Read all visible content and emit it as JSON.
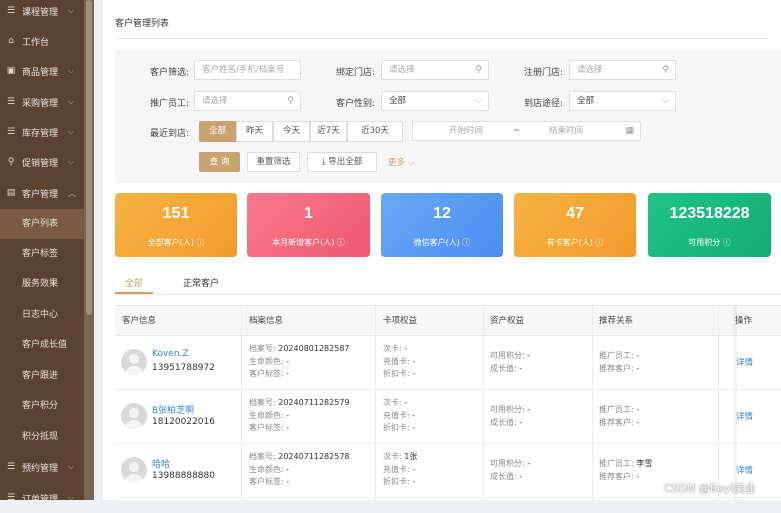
{
  "sidebar": {
    "items": [
      {
        "label": "课程管理",
        "icon": "list-icon",
        "expanded": false
      },
      {
        "label": "工作台",
        "icon": "home-icon"
      },
      {
        "label": "商品管理",
        "icon": "box-icon",
        "expanded": false
      },
      {
        "label": "采购管理",
        "icon": "list-icon",
        "expanded": false
      },
      {
        "label": "库存管理",
        "icon": "list-icon",
        "expanded": false
      },
      {
        "label": "促销管理",
        "icon": "tag-icon",
        "expanded": false
      },
      {
        "label": "客户管理",
        "icon": "user-card-icon",
        "expanded": true
      }
    ],
    "submenu": [
      "客户列表",
      "客户标签",
      "服务效果",
      "日志中心",
      "客户成长值",
      "客户跟进",
      "客户积分",
      "积分抵现"
    ],
    "active_sub": "客户列表",
    "tail": [
      {
        "label": "预约管理",
        "icon": "list-icon",
        "expanded": false
      },
      {
        "label": "订单管理",
        "icon": "list-icon",
        "expanded": false
      }
    ]
  },
  "page": {
    "title": "客户管理列表"
  },
  "filters": {
    "customer_filter": {
      "label": "客户筛选:",
      "placeholder": "客户姓名/手机/档案号"
    },
    "bound_store": {
      "label": "绑定门店:",
      "placeholder": "请选择"
    },
    "register_store": {
      "label": "注册门店:",
      "placeholder": "请选择"
    },
    "promoter": {
      "label": "推广员工:",
      "placeholder": "请选择"
    },
    "gender": {
      "label": "客户性别:",
      "value": "全部"
    },
    "channel": {
      "label": "到店途径:",
      "value": "全部"
    },
    "recent": {
      "label": "最近到店:",
      "options": [
        "全部",
        "昨天",
        "今天",
        "近7天",
        "近30天"
      ],
      "selected": "全部"
    },
    "date_range": {
      "start_placeholder": "开始时间",
      "separator": "~",
      "end_placeholder": "结束时间"
    },
    "buttons": {
      "query": "查 询",
      "reset": "重置筛选",
      "export": "导出全部",
      "more": "更多"
    }
  },
  "stats": [
    {
      "value": "151",
      "label": "全部客户(人)",
      "color": "#f5a536"
    },
    {
      "value": "1",
      "label": "本月新增客户(人)",
      "color": "#f2667c"
    },
    {
      "value": "12",
      "label": "微信客户(人)",
      "color": "#5b9ef2"
    },
    {
      "value": "47",
      "label": "有卡客户(人)",
      "color": "#f5a536"
    },
    {
      "value": "123518228",
      "label": "可用积分",
      "color": "#17b780"
    }
  ],
  "tabs": [
    {
      "label": "全部",
      "active": true
    },
    {
      "label": "正常客户",
      "active": false
    }
  ],
  "table": {
    "headers": [
      "客户信息",
      "档案信息",
      "卡项权益",
      "资产权益",
      "推荐关系",
      "操作"
    ],
    "archive_labels": [
      "档案号:",
      "生命颜色:",
      "客户标签:"
    ],
    "card_labels": [
      "次卡:",
      "充值卡:",
      "折扣卡:"
    ],
    "asset_labels": [
      "可用积分:",
      "成长值:"
    ],
    "referral_labels": [
      "推广员工:",
      "推荐客户:"
    ],
    "action_label": "详情",
    "rows": [
      {
        "name": "Koven.Z",
        "phone": "13951788972",
        "archive_no": "20240801282587",
        "life_color": "-",
        "tags": "-",
        "times_card": "-",
        "recharge_card": "-",
        "discount_card": "-",
        "points": "-",
        "growth": "-",
        "promoter": "-",
        "referrer": "-"
      },
      {
        "name": "B张柏芝啊",
        "phone": "18120022016",
        "archive_no": "20240711282579",
        "life_color": "-",
        "tags": "-",
        "times_card": "-",
        "recharge_card": "-",
        "discount_card": "-",
        "points": "-",
        "growth": "-",
        "promoter": "-",
        "referrer": "-"
      },
      {
        "name": "哈哈",
        "phone": "13988888880",
        "archive_no": "20240711282578",
        "life_color": "-",
        "tags": "-",
        "times_card": "1张",
        "recharge_card": "-",
        "discount_card": "-",
        "points": "-",
        "growth": "-",
        "promoter": "李雪",
        "referrer": "-"
      }
    ]
  },
  "watermark": "CSDN @Boyi美业"
}
